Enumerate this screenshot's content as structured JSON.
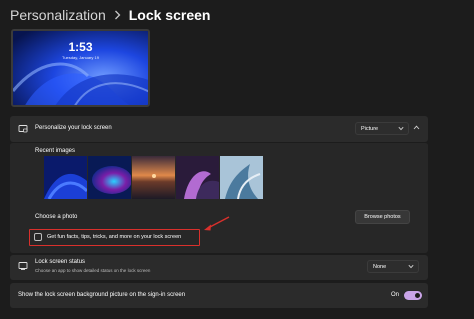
{
  "breadcrumb": {
    "parent": "Personalization",
    "separator_icon": "chevron-right-icon",
    "current": "Lock screen"
  },
  "preview": {
    "time": "1:53",
    "date": "Tuesday, January 19"
  },
  "personalize": {
    "label": "Personalize your lock screen",
    "icon": "lock-screen-icon",
    "dropdown_value": "Picture",
    "recent_images_label": "Recent images",
    "images": [
      {
        "name": "blue-bloom",
        "colors": [
          "#1b3fd6",
          "#0a1a6b",
          "#4b7bff"
        ]
      },
      {
        "name": "glow-sphere",
        "colors": [
          "#0b2a8a",
          "#7a1ea8",
          "#2ad1ff"
        ]
      },
      {
        "name": "sunset-lake",
        "colors": [
          "#e0894a",
          "#6b3a2a",
          "#1d1a26"
        ]
      },
      {
        "name": "purple-ribbon",
        "colors": [
          "#2a1b3a",
          "#b26bd1",
          "#3d2a5c"
        ]
      },
      {
        "name": "light-bloom",
        "colors": [
          "#a9c4d8",
          "#4b7a9e",
          "#e6eef5"
        ]
      }
    ],
    "choose_photo_label": "Choose a photo",
    "browse_button": "Browse photos",
    "fun_facts_label": "Get fun facts, tips, tricks, and more on your lock screen",
    "fun_facts_checked": false
  },
  "status": {
    "label": "Lock screen status",
    "description": "Choose an app to show detailed status on the lock screen",
    "icon": "lock-status-icon",
    "dropdown_value": "None"
  },
  "signin": {
    "label": "Show the lock screen background picture on the sign-in screen",
    "toggle_label": "On",
    "toggle_on": true
  },
  "colors": {
    "accent": "#c9a4e8",
    "highlight": "#d9302c",
    "background": "#1c1c1c",
    "card": "#2b2b2b"
  }
}
